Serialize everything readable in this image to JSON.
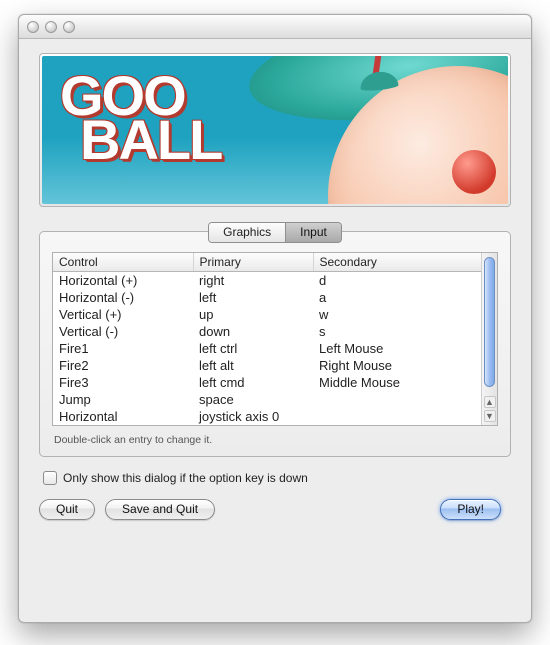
{
  "banner": {
    "title_line1": "GOO",
    "title_line2": "BALL"
  },
  "tabs": {
    "graphics": "Graphics",
    "input": "Input",
    "active": "input"
  },
  "table": {
    "headers": {
      "control": "Control",
      "primary": "Primary",
      "secondary": "Secondary"
    },
    "rows": [
      {
        "control": "Horizontal (+)",
        "primary": "right",
        "secondary": "d"
      },
      {
        "control": "Horizontal (-)",
        "primary": "left",
        "secondary": "a"
      },
      {
        "control": "Vertical (+)",
        "primary": "up",
        "secondary": "w"
      },
      {
        "control": "Vertical (-)",
        "primary": "down",
        "secondary": "s"
      },
      {
        "control": "Fire1",
        "primary": "left ctrl",
        "secondary": "Left Mouse"
      },
      {
        "control": "Fire2",
        "primary": "left alt",
        "secondary": "Right Mouse"
      },
      {
        "control": "Fire3",
        "primary": "left cmd",
        "secondary": "Middle Mouse"
      },
      {
        "control": "Jump",
        "primary": "space",
        "secondary": ""
      },
      {
        "control": "Horizontal",
        "primary": "joystick axis 0",
        "secondary": ""
      }
    ]
  },
  "hint": "Double-click an entry to change it.",
  "checkbox": {
    "label": "Only show this dialog if the option key is down",
    "checked": false
  },
  "buttons": {
    "quit": "Quit",
    "save_quit": "Save and Quit",
    "play": "Play!"
  }
}
